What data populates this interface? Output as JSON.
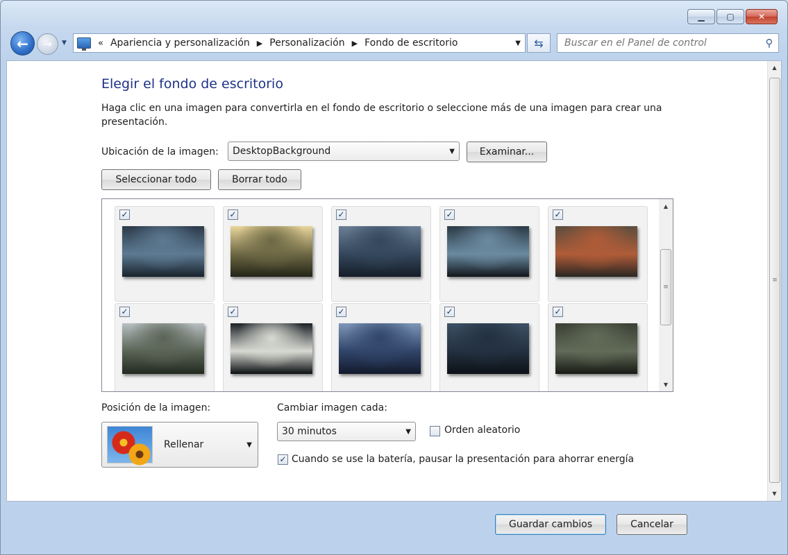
{
  "window": {
    "caption": {
      "minimize_icon": "minimize-icon",
      "maximize_icon": "maximize-icon",
      "close_icon": "close-icon"
    }
  },
  "nav": {
    "back_icon": "back-arrow-icon",
    "forward_icon": "forward-arrow-icon",
    "breadcrumb_lead": "«",
    "breadcrumbs": [
      "Apariencia y personalización",
      "Personalización",
      "Fondo de escritorio"
    ],
    "search_placeholder": "Buscar en el Panel de control"
  },
  "main": {
    "title": "Elegir el fondo de escritorio",
    "description": "Haga clic en una imagen para convertirla en el fondo de escritorio o seleccione más de una imagen para crear una presentación.",
    "location_label": "Ubicación de la imagen:",
    "location_value": "DesktopBackground",
    "browse_label": "Examinar...",
    "select_all_label": "Seleccionar todo",
    "clear_all_label": "Borrar todo",
    "thumbnails": [
      {
        "checked": true,
        "colors": [
          "#2c3a4a",
          "#5d7a92",
          "#18222c"
        ]
      },
      {
        "checked": true,
        "colors": [
          "#e8d59a",
          "#6d6844",
          "#232418"
        ]
      },
      {
        "checked": true,
        "colors": [
          "#6a7f95",
          "#34475c",
          "#151d28"
        ]
      },
      {
        "checked": true,
        "colors": [
          "#2b3a46",
          "#6b8aa0",
          "#10161c"
        ]
      },
      {
        "checked": true,
        "colors": [
          "#5c4e3e",
          "#b05c38",
          "#2a2622"
        ]
      },
      {
        "checked": true,
        "colors": [
          "#b8bfc2",
          "#5a6456",
          "#222a20"
        ]
      },
      {
        "checked": true,
        "colors": [
          "#1c2126",
          "#d7d9d2",
          "#0c0f12"
        ]
      },
      {
        "checked": true,
        "colors": [
          "#7c96b8",
          "#31456a",
          "#121a2c"
        ]
      },
      {
        "checked": true,
        "colors": [
          "#3c5064",
          "#233040",
          "#0c1116"
        ]
      },
      {
        "checked": true,
        "colors": [
          "#3a4034",
          "#626a58",
          "#171a14"
        ]
      }
    ],
    "position_label": "Posición de la imagen:",
    "position_value": "Rellenar",
    "interval_label": "Cambiar imagen cada:",
    "interval_value": "30 minutos",
    "shuffle_label": "Orden aleatorio",
    "shuffle_checked": false,
    "battery_label": "Cuando se use la batería, pausar la presentación para ahorrar energía",
    "battery_checked": true
  },
  "footer": {
    "save_label": "Guardar cambios",
    "cancel_label": "Cancelar"
  }
}
